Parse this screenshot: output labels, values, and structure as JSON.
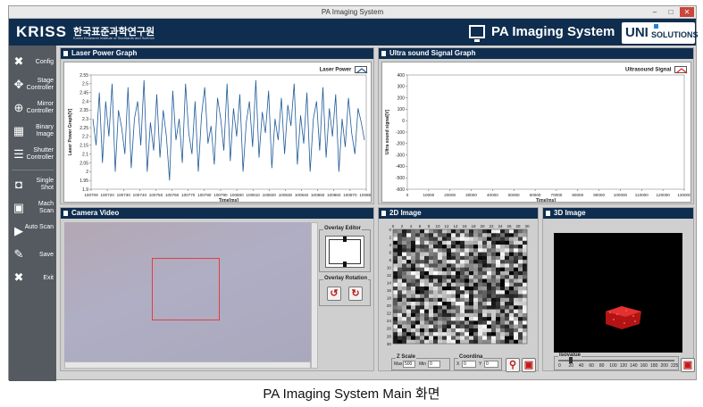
{
  "window": {
    "title": "PA Imaging System",
    "min": "–",
    "max": "□",
    "close": "✕"
  },
  "header": {
    "logo_text": "KRISS",
    "logo_korean": "한국표준과학연구원",
    "logo_sub": "Korea Research Institute of Standards and Science",
    "app_title": "PA Imaging System",
    "brand_main": "UNI",
    "brand_sub": "SOLUTIONS"
  },
  "sidebar": {
    "items": [
      {
        "name": "config",
        "icon": "wrench-icon",
        "glyph": "✖",
        "label": "Config"
      },
      {
        "name": "stage-controller",
        "icon": "move-arrows-icon",
        "glyph": "✥",
        "label": "Stage Controller"
      },
      {
        "name": "mirror-controller",
        "icon": "crosshair-icon",
        "glyph": "⊕",
        "label": "Mirror Controller"
      },
      {
        "name": "binary-image",
        "icon": "grid-icon",
        "glyph": "▦",
        "label": "Binary Image"
      },
      {
        "name": "shutter-controller",
        "icon": "database-icon",
        "glyph": "☰",
        "label": "Shutter Controller"
      },
      {
        "name": "single-shot",
        "icon": "camera-icon",
        "glyph": "◘",
        "label": "Single Shot"
      },
      {
        "name": "mach-scan",
        "icon": "tape-icon",
        "glyph": "▣",
        "label": "Mach Scan"
      },
      {
        "name": "auto-scan",
        "icon": "play-icon",
        "glyph": "▶",
        "label": "Auto Scan"
      },
      {
        "name": "save",
        "icon": "edit-icon",
        "glyph": "✎",
        "label": "Save"
      },
      {
        "name": "exit",
        "icon": "close-circle-icon",
        "glyph": "✖",
        "label": "Exit"
      }
    ]
  },
  "panels": {
    "laser": {
      "title": "Laser Power Graph",
      "legend": "Laser Power"
    },
    "ultra": {
      "title": "Ultra sound Signal Graph",
      "legend": "Ultrasound Signal"
    },
    "camera": {
      "title": "Camera Video",
      "overlay_editor": "Overlay Editor",
      "overlay_rotation": "Overlay Rotation",
      "rotate_ccw_glyph": "↺",
      "rotate_cw_glyph": "↻"
    },
    "image2d": {
      "title": "2D Image",
      "zscale_label": "Z Scale",
      "max_label": "Max",
      "max_value": "500",
      "min_label": "Min",
      "min_value": "0",
      "coord_label": "Coordina",
      "x_label": "X",
      "x_value": "0",
      "y_label": "Y",
      "y_value": "0",
      "zoom_glyph": "⚲",
      "save_glyph": "▣"
    },
    "image3d": {
      "title": "3D Image",
      "isovalue_label": "Isovalue",
      "slider_ticks": [
        "0",
        "20",
        "40",
        "60",
        "80",
        "100",
        "120",
        "140",
        "160",
        "180",
        "200",
        "225"
      ],
      "save_glyph": "▣"
    }
  },
  "chart_data": [
    {
      "type": "line",
      "title": "Laser Power Graph",
      "xlabel": "Time[ms]",
      "ylabel": "Laser Power Graph[V]",
      "xlim": [
        100709,
        100880
      ],
      "ylim": [
        1.9,
        2.55
      ],
      "x_ticks": [
        "100709",
        "100720",
        "100730",
        "100740",
        "100750",
        "100760",
        "100770",
        "100780",
        "100790",
        "100800",
        "100810",
        "100820",
        "100830",
        "100840",
        "100850",
        "100860",
        "100870",
        "100880"
      ],
      "y_ticks": [
        "2.55",
        "2.5",
        "2.45",
        "2.4",
        "2.35",
        "2.3",
        "2.25",
        "2.2",
        "2.15",
        "2.1",
        "2.05",
        "2",
        "1.95",
        "1.9"
      ],
      "series": [
        {
          "name": "Laser Power",
          "values": [
            2.3,
            2.15,
            2.45,
            2.05,
            2.4,
            2.2,
            2.5,
            2.0,
            2.35,
            2.25,
            2.1,
            2.48,
            2.02,
            2.3,
            2.4,
            2.15,
            2.52,
            2.0,
            2.28,
            2.12,
            2.44,
            2.08,
            2.35,
            2.2,
            1.95,
            2.46,
            2.18,
            2.3,
            2.05,
            2.5,
            2.22,
            2.1,
            2.4,
            2.0,
            2.32,
            2.48,
            2.16,
            2.26,
            2.04,
            2.42,
            2.3,
            2.12,
            2.5,
            2.06,
            2.36,
            2.2,
            2.44,
            2.0,
            2.28,
            2.4,
            2.14,
            2.52,
            2.08,
            2.34,
            2.22,
            2.46,
            2.02,
            2.3,
            2.18,
            2.42,
            2.1,
            2.38,
            2.26,
            2.5,
            2.04,
            2.32,
            2.16,
            2.45,
            2.0,
            2.3,
            2.4,
            2.12,
            2.48,
            2.08,
            2.36,
            2.2,
            2.44,
            2.0,
            2.3,
            2.14,
            2.42,
            2.22,
            2.1,
            2.36,
            2.28,
            2.18
          ]
        }
      ]
    },
    {
      "type": "line",
      "title": "Ultra sound Signal Graph",
      "xlabel": "Time[ms]",
      "ylabel": "Ultra sound signal[V]",
      "xlim": [
        0,
        130000
      ],
      "ylim": [
        -600,
        400
      ],
      "x_ticks": [
        "0",
        "10000",
        "20000",
        "30000",
        "40000",
        "50000",
        "60000",
        "70000",
        "80000",
        "90000",
        "100000",
        "110000",
        "120000",
        "130000"
      ],
      "y_ticks": [
        "400",
        "300",
        "200",
        "100",
        "0",
        "-100",
        "-200",
        "-300",
        "-400",
        "-500",
        "-600"
      ],
      "series": [
        {
          "name": "Ultrasound Signal",
          "values": []
        }
      ]
    },
    {
      "type": "heatmap",
      "title": "2D Image",
      "x_ticks": [
        "0",
        "2",
        "4",
        "6",
        "8",
        "10",
        "12",
        "14",
        "16",
        "18",
        "20",
        "22",
        "24",
        "26",
        "28",
        "30"
      ],
      "y_ticks": [
        "0",
        "2",
        "4",
        "6",
        "8",
        "10",
        "12",
        "14",
        "16",
        "18",
        "20",
        "22",
        "24",
        "26",
        "28",
        "30"
      ],
      "grid_size": [
        30,
        30
      ]
    }
  ],
  "caption": "PA Imaging System Main 화면"
}
